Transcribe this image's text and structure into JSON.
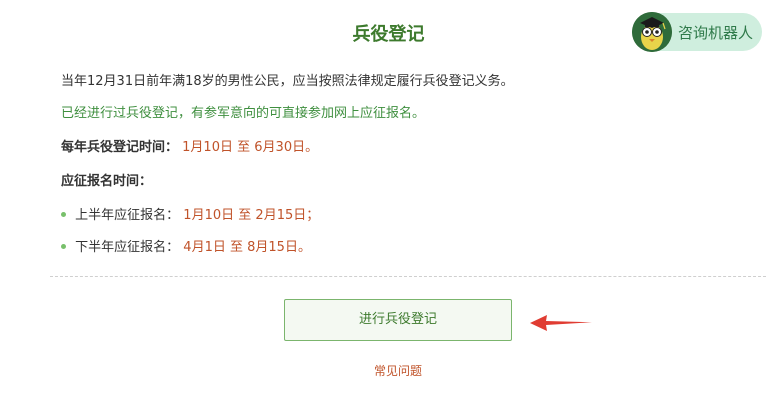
{
  "header": {
    "title": "兵役登记",
    "robot_label": "咨询机器人"
  },
  "info": {
    "line1": "当年12月31日前年满18岁的男性公民，应当按照法律规定履行兵役登记义务。",
    "line2": "已经进行过兵役登记，有参军意向的可直接参加网上应征报名。",
    "registration_time_label": "每年兵役登记时间：",
    "registration_time_start": "1月10日",
    "registration_time_sep": "至",
    "registration_time_end": "6月30日。",
    "enlistment_time_label": "应征报名时间：",
    "periods": [
      {
        "label": "上半年应征报名：",
        "start": "1月10日",
        "sep": "至",
        "end": "2月15日；"
      },
      {
        "label": "下半年应征报名：",
        "start": "4月1日",
        "sep": "至",
        "end": "8月15日。"
      }
    ]
  },
  "actions": {
    "register_button": "进行兵役登记",
    "faq_link": "常见问题"
  },
  "colors": {
    "title_green": "#3d7a2d",
    "accent_orange": "#c0532a",
    "arrow_red": "#e03c32",
    "bullet_green": "#78c06b"
  }
}
